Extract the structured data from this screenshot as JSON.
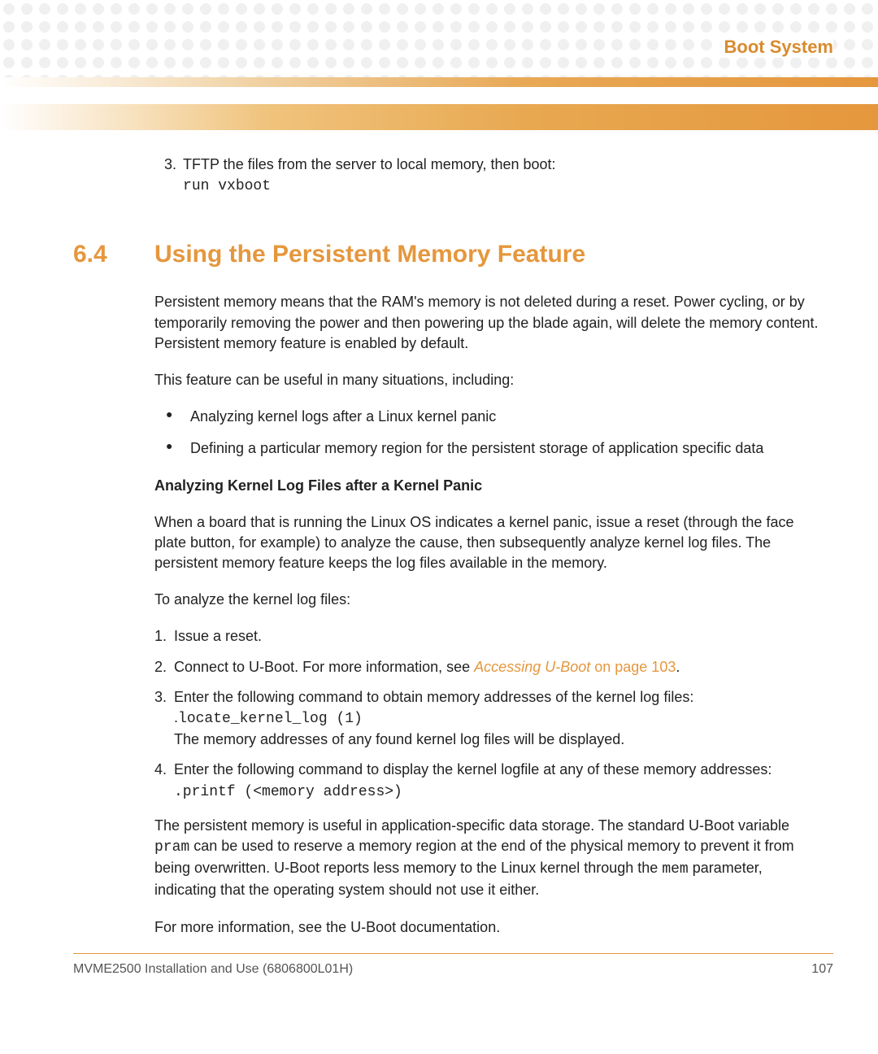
{
  "header": {
    "chapter_title": "Boot System"
  },
  "step3": {
    "number": "3.",
    "text": "TFTP the files from the server to local memory, then boot:",
    "code": "run vxboot"
  },
  "section": {
    "number": "6.4",
    "title": "Using the Persistent Memory Feature"
  },
  "para1": "Persistent memory means that the RAM's memory is not deleted during a reset. Power cycling, or by temporarily removing the power and then powering up the blade again, will delete the memory content. Persistent memory feature is enabled by default.",
  "para2": "This feature can be useful in many situations, including:",
  "bullets": [
    "Analyzing kernel logs after a Linux kernel panic",
    "Defining a particular memory region for the persistent storage of application specific data"
  ],
  "subhead": "Analyzing Kernel Log Files after a Kernel Panic",
  "para3": "When a board that is running the Linux OS indicates a kernel panic, issue a reset (through the face plate button, for example) to analyze the cause, then subsequently analyze kernel log files. The persistent memory feature keeps the log files available in the memory.",
  "para4": "To analyze the kernel log files:",
  "ol": {
    "s1": {
      "n": "1.",
      "t": "Issue a reset."
    },
    "s2": {
      "n": "2.",
      "t1": "Connect to U-Boot. For more information, see ",
      "link_italic": "Accessing U-Boot",
      "link_plain": " on page 103",
      "t2": "."
    },
    "s3": {
      "n": "3.",
      "t1": "Enter the following command to obtain memory addresses of the kernel log files: .",
      "code": "locate_kernel_log (1)",
      "t2": "The memory addresses of any found kernel log files will be displayed."
    },
    "s4": {
      "n": "4.",
      "t1": "Enter the following command to display the kernel logfile at any of these memory addresses: ",
      "code": ".printf (<memory address>)"
    }
  },
  "para5a": "The persistent memory is useful in application-specific data storage. The standard U-Boot variable ",
  "code5a": "pram",
  "para5b": " can be used to reserve a memory region at the end of the physical memory to prevent it from being overwritten. U-Boot reports less memory to the Linux kernel through the ",
  "code5b": "mem",
  "para5c": " parameter, indicating that the operating system should not use it either.",
  "para6": "For more information, see the U-Boot documentation.",
  "footer": {
    "left": "MVME2500 Installation and Use (6806800L01H)",
    "right": "107"
  }
}
